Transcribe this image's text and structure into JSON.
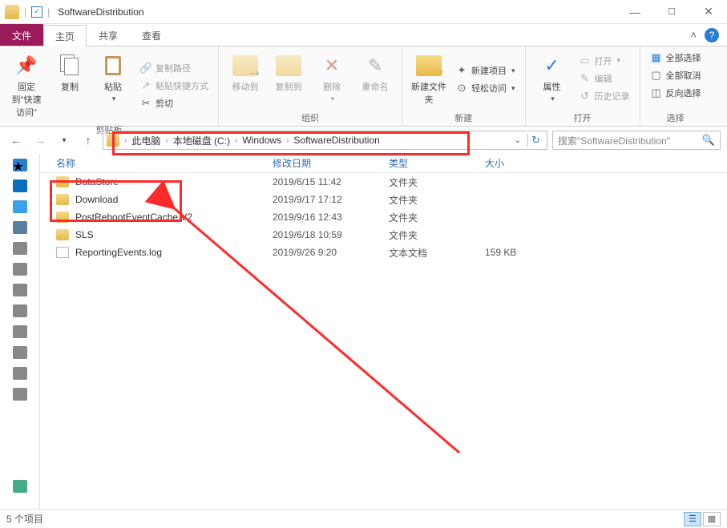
{
  "title": "SoftwareDistribution",
  "tabs": {
    "file": "文件",
    "home": "主页",
    "share": "共享",
    "view": "查看"
  },
  "ribbon": {
    "pin": "固定到\"快速访问\"",
    "copy": "复制",
    "paste": "粘贴",
    "copy_path": "复制路径",
    "paste_shortcut": "粘贴快捷方式",
    "cut": "剪切",
    "clipboard": "剪贴板",
    "move_to": "移动到",
    "copy_to": "复制到",
    "delete": "删除",
    "rename": "重命名",
    "organize": "组织",
    "new_folder": "新建文件夹",
    "new_item": "新建项目",
    "easy_access": "轻松访问",
    "new": "新建",
    "properties": "属性",
    "open": "打开",
    "edit": "编辑",
    "history": "历史记录",
    "open_group": "打开",
    "select_all": "全部选择",
    "select_none": "全部取消",
    "invert": "反向选择",
    "select": "选择"
  },
  "breadcrumb": [
    "此电脑",
    "本地磁盘 (C:)",
    "Windows",
    "SoftwareDistribution"
  ],
  "search_placeholder": "搜索\"SoftwareDistribution\"",
  "columns": {
    "name": "名称",
    "date": "修改日期",
    "type": "类型",
    "size": "大小"
  },
  "items": [
    {
      "name": "DataStore",
      "date": "2019/6/15 11:42",
      "type": "文件夹",
      "size": "",
      "kind": "folder"
    },
    {
      "name": "Download",
      "date": "2019/9/17 17:12",
      "type": "文件夹",
      "size": "",
      "kind": "folder"
    },
    {
      "name": "PostRebootEventCache.V2",
      "date": "2019/9/16 12:43",
      "type": "文件夹",
      "size": "",
      "kind": "folder"
    },
    {
      "name": "SLS",
      "date": "2019/6/18 10:59",
      "type": "文件夹",
      "size": "",
      "kind": "folder"
    },
    {
      "name": "ReportingEvents.log",
      "date": "2019/9/26 9:20",
      "type": "文本文档",
      "size": "159 KB",
      "kind": "file"
    }
  ],
  "status": "5 个项目",
  "colors": {
    "accent": "#9b1a5a",
    "annotation": "#ff2a2a"
  }
}
